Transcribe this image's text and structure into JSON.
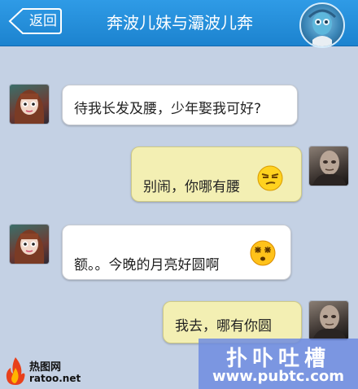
{
  "header": {
    "back_label": "返回",
    "title": "奔波儿妹与灞波儿奔"
  },
  "messages": [
    {
      "side": "received",
      "text": "待我长发及腰，少年娶我可好?"
    },
    {
      "side": "sent",
      "text": "别闹，你哪有腰",
      "emoji": "smug-emoji-icon"
    },
    {
      "side": "received",
      "text": "额。。今晚的月亮好圆啊",
      "emoji": "dizzy-emoji-icon"
    },
    {
      "side": "sent",
      "text": "我去，哪有你圆"
    }
  ],
  "watermark_left": {
    "line1": "热图网",
    "line2": "ratoo.net"
  },
  "watermark_right": {
    "line1": "扑卟吐槽",
    "line2": "www.pubtc.com"
  },
  "colors": {
    "topbar": "#1c83cf",
    "chat_bg": "#c4d1e4",
    "bubble_received": "#ffffff",
    "bubble_sent": "#f3efb3"
  }
}
